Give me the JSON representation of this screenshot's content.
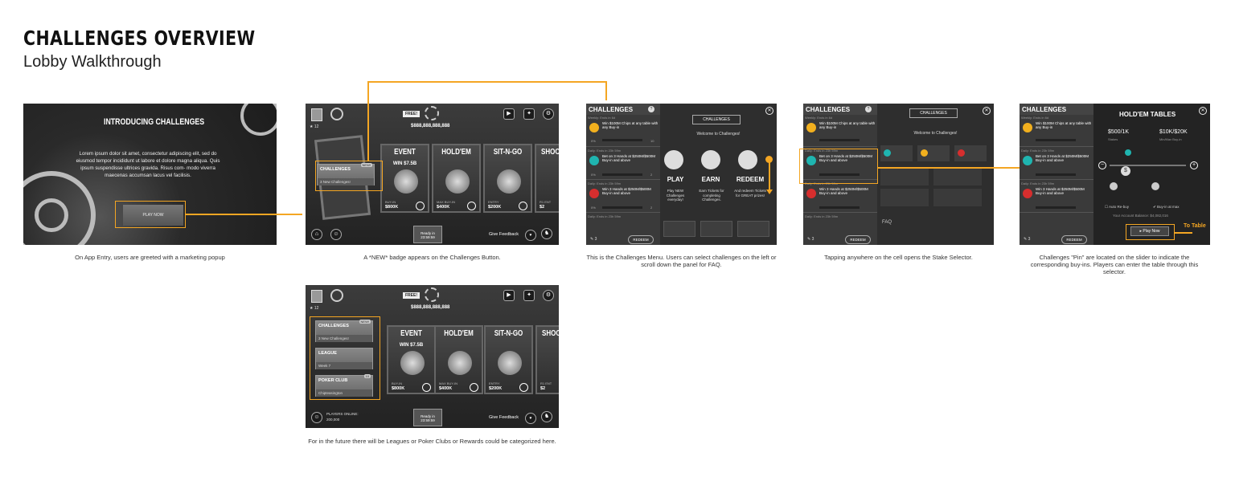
{
  "page": {
    "title": "CHALLENGES OVERVIEW",
    "subtitle": "Lobby Walkthrough"
  },
  "colors": {
    "accent": "#f4a623",
    "panel_dark": "#2b2b2b",
    "text": "#222222"
  },
  "intro": {
    "heading": "INTRODUCING CHALLENGES",
    "body": "Lorem ipsum dolor sit amet, consectetur adipiscing elit, sed do eiusmod tempor incididunt ut labore et dolore magna aliqua. Quis ipsum suspendisse ultrices gravida. Risus com- modo viverra maecenas accumsan lacus vel facilisis.",
    "button": "PLAY NOW",
    "caption": "On App Entry, users are greeted with a marketing popup"
  },
  "lobby": {
    "free": "FREE!",
    "balance": "$888,888,888,888",
    "level": "12",
    "ready": "Ready in",
    "timer": "23:59:59",
    "feedback": "Give Feedback",
    "menu_challenges": "CHALLENGES",
    "menu_challenges_sub": "3 New Challenges!",
    "new_badge": "NEW!",
    "cards": [
      {
        "title": "EVENT",
        "sub": "WIN $7.5B",
        "buy": "BUY-IN",
        "amount": "$800K"
      },
      {
        "title": "HOLD'EM",
        "sub": "",
        "buy": "MAX BUY-IN",
        "amount": "$400K"
      },
      {
        "title": "SIT-N-GO",
        "sub": "",
        "buy": "ENTRY",
        "amount": "$200K"
      },
      {
        "title": "SHOO",
        "sub": "",
        "buy": "R1 ENT",
        "amount": "$2"
      }
    ],
    "caption": "A *NEW* badge appears on the Challenges Button."
  },
  "lobby2": {
    "menu_league": "LEAGUE",
    "menu_league_sub": "Week 7",
    "menu_club": "POKER CLUB",
    "menu_club_sub": "Chipteasington",
    "club_badge": "10",
    "players_label": "PLAYERS ONLINE:",
    "players_count": "200,000",
    "caption": "For in the future there will be Leagues or Poker Clubs or Rewards could be categorized here."
  },
  "challenges": {
    "header": "CHALLENGES",
    "weekly": "Weekly: Ends in 6d",
    "daily": "Daily: Ends in 23h 59m",
    "items": [
      {
        "text": "Win $100M Chips at any table with any Buy-in",
        "pct": "0%",
        "reward": "10",
        "color": "#f2b01e"
      },
      {
        "text": "Bet on 3 Hands at $250M/$500M Buy-in and above",
        "pct": "0%",
        "reward": "2",
        "color": "#1fb5b0"
      },
      {
        "text": "Win 3 Hands at $250M/$500M Buy-in and above",
        "pct": "0%",
        "reward": "2",
        "color": "#d62e2e"
      }
    ],
    "tickets": "3",
    "redeem": "REDEEM",
    "logo": "CHALLENGES",
    "welcome": "Welcome to Challenges!",
    "play": "PLAY",
    "earn": "EARN",
    "redeem_big": "REDEEM",
    "play_desc": "Play NEW Challenges everyday!",
    "earn_desc": "Earn Tickets for completing Challenges.",
    "redeem_desc": "And redeem Tickets for GREAT prizes!",
    "caption": "This is the Challenges Menu. Users can select challenges on the left or scroll down the panel for FAQ."
  },
  "faq_panel": {
    "faq": "FAQ",
    "caption": "Tapping anywhere on the cell opens the Stake Selector."
  },
  "holdem": {
    "title": "HOLD'EM TABLES",
    "stakes": "$500/1K",
    "stakes_label": "Stakes",
    "minmax": "$10K/$20K",
    "minmax_label": "Min/Max Buy-in",
    "auto": "Auto Re-buy",
    "buy_max": "Buy-in at max",
    "balance": "Your Account Balance: $4,082,016",
    "play": "Play Now",
    "to_table": "To Table",
    "caption": "Challenges \"Pin\" are located on the slider to indicate the corresponding buy-ins. Players can enter the table through this selector."
  }
}
